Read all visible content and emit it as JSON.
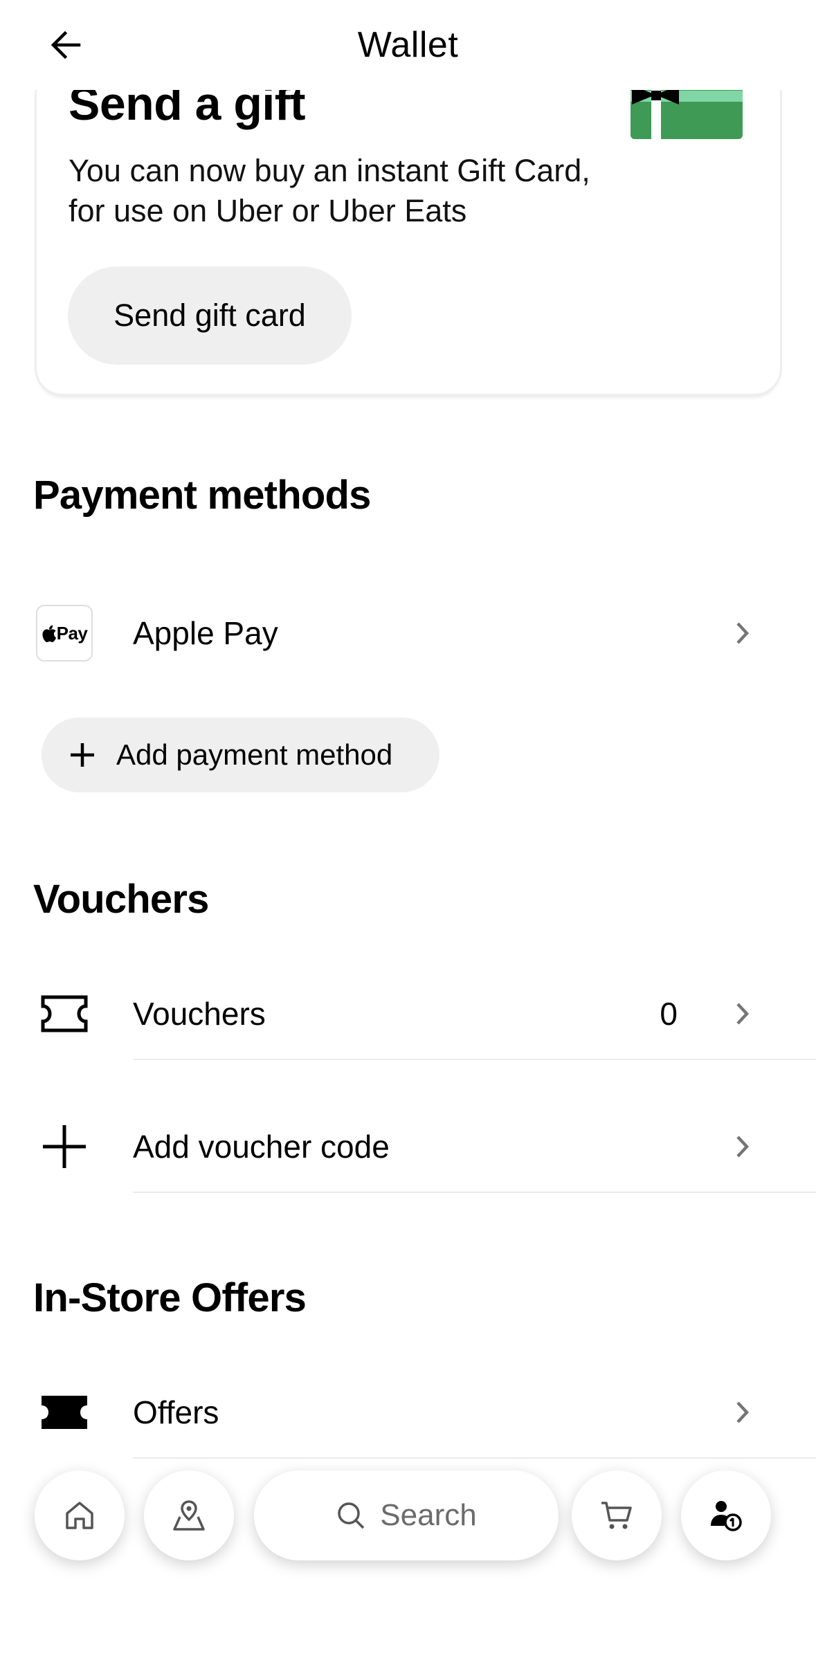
{
  "header": {
    "title": "Wallet",
    "back_icon": "arrow-left-icon"
  },
  "gift": {
    "title": "Send a gift",
    "description": "You can now buy an instant Gift Card, for use on Uber or Uber Eats",
    "button_label": "Send gift card",
    "illustration": "gift-card-illustration",
    "colors": {
      "card": "#3e9a54",
      "ribbon": "#80d6a4",
      "bow": "#000000"
    }
  },
  "payment_methods": {
    "heading": "Payment methods",
    "items": [
      {
        "label": "Apple Pay",
        "badge_text": "Pay",
        "icon": "apple-pay-icon"
      }
    ],
    "add_label": "Add payment method"
  },
  "vouchers": {
    "heading": "Vouchers",
    "items": [
      {
        "label": "Vouchers",
        "value": "0",
        "icon": "ticket-icon"
      },
      {
        "label": "Add voucher code",
        "icon": "plus-icon"
      }
    ]
  },
  "in_store_offers": {
    "heading": "In-Store Offers",
    "items": [
      {
        "label": "Offers",
        "icon": "ticket-filled-icon"
      }
    ]
  },
  "bottom_nav": {
    "search_label": "Search",
    "items": [
      "home-icon",
      "location-pin-icon",
      "search-icon",
      "cart-icon",
      "account-icon"
    ]
  },
  "colors": {
    "chip_background": "#efefef",
    "chevron": "#757575",
    "divider": "#ececec"
  }
}
